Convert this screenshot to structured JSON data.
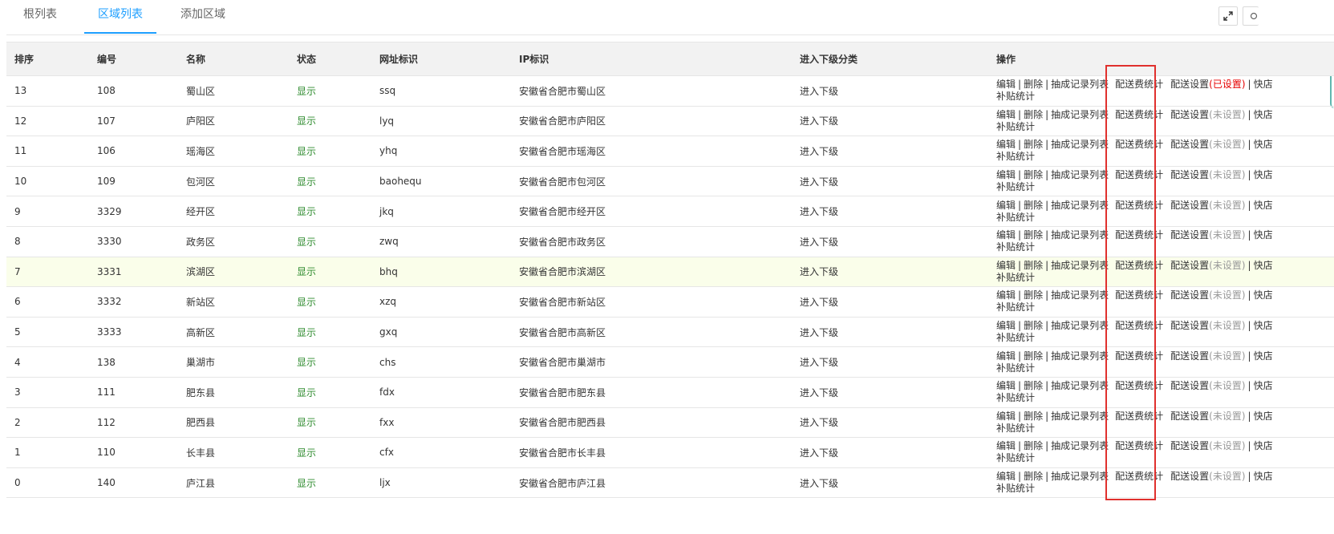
{
  "tabs": [
    {
      "label": "根列表"
    },
    {
      "label": "区域列表"
    },
    {
      "label": "添加区域"
    }
  ],
  "toolbar": {
    "expand_icon": "expand-icon",
    "tool2_icon": "partial-tool-icon"
  },
  "table": {
    "headers": [
      "排序",
      "编号",
      "名称",
      "状态",
      "网址标识",
      "IP标识",
      "进入下级分类",
      "操作"
    ],
    "ops_labels": {
      "edit": "编辑",
      "delete": "删除",
      "commission": "抽成记录列表",
      "delivery_stats": "配送费统计",
      "delivery_settings": "配送设置",
      "set_yes": "(已设置)",
      "set_no": "(未设置)",
      "quick": "快店",
      "subsidy": "补贴统计",
      "separator": "|"
    },
    "rows": [
      {
        "sort": "13",
        "id": "108",
        "name": "蜀山区",
        "status": "显示",
        "url": "ssq",
        "ip": "安徽省合肥市蜀山区",
        "enter": "进入下级",
        "configured": true
      },
      {
        "sort": "12",
        "id": "107",
        "name": "庐阳区",
        "status": "显示",
        "url": "lyq",
        "ip": "安徽省合肥市庐阳区",
        "enter": "进入下级",
        "configured": false
      },
      {
        "sort": "11",
        "id": "106",
        "name": "瑶海区",
        "status": "显示",
        "url": "yhq",
        "ip": "安徽省合肥市瑶海区",
        "enter": "进入下级",
        "configured": false
      },
      {
        "sort": "10",
        "id": "109",
        "name": "包河区",
        "status": "显示",
        "url": "baohequ",
        "ip": "安徽省合肥市包河区",
        "enter": "进入下级",
        "configured": false
      },
      {
        "sort": "9",
        "id": "3329",
        "name": "经开区",
        "status": "显示",
        "url": "jkq",
        "ip": "安徽省合肥市经开区",
        "enter": "进入下级",
        "configured": false
      },
      {
        "sort": "8",
        "id": "3330",
        "name": "政务区",
        "status": "显示",
        "url": "zwq",
        "ip": "安徽省合肥市政务区",
        "enter": "进入下级",
        "configured": false
      },
      {
        "sort": "7",
        "id": "3331",
        "name": "滨湖区",
        "status": "显示",
        "url": "bhq",
        "ip": "安徽省合肥市滨湖区",
        "enter": "进入下级",
        "configured": false
      },
      {
        "sort": "6",
        "id": "3332",
        "name": "新站区",
        "status": "显示",
        "url": "xzq",
        "ip": "安徽省合肥市新站区",
        "enter": "进入下级",
        "configured": false
      },
      {
        "sort": "5",
        "id": "3333",
        "name": "高新区",
        "status": "显示",
        "url": "gxq",
        "ip": "安徽省合肥市高新区",
        "enter": "进入下级",
        "configured": false
      },
      {
        "sort": "4",
        "id": "138",
        "name": "巢湖市",
        "status": "显示",
        "url": "chs",
        "ip": "安徽省合肥市巢湖市",
        "enter": "进入下级",
        "configured": false
      },
      {
        "sort": "3",
        "id": "111",
        "name": "肥东县",
        "status": "显示",
        "url": "fdx",
        "ip": "安徽省合肥市肥东县",
        "enter": "进入下级",
        "configured": false
      },
      {
        "sort": "2",
        "id": "112",
        "name": "肥西县",
        "status": "显示",
        "url": "fxx",
        "ip": "安徽省合肥市肥西县",
        "enter": "进入下级",
        "configured": false
      },
      {
        "sort": "1",
        "id": "110",
        "name": "长丰县",
        "status": "显示",
        "url": "cfx",
        "ip": "安徽省合肥市长丰县",
        "enter": "进入下级",
        "configured": false
      },
      {
        "sort": "0",
        "id": "140",
        "name": "庐江县",
        "status": "显示",
        "url": "ljx",
        "ip": "安徽省合肥市庐江县",
        "enter": "进入下级",
        "configured": false
      }
    ]
  },
  "colors": {
    "accent": "#1e9fff",
    "status_green": "#2e8b2e",
    "highlight_box": "#e0302d",
    "row_highlight": "#fafeea",
    "set_yes": "#e60000"
  }
}
